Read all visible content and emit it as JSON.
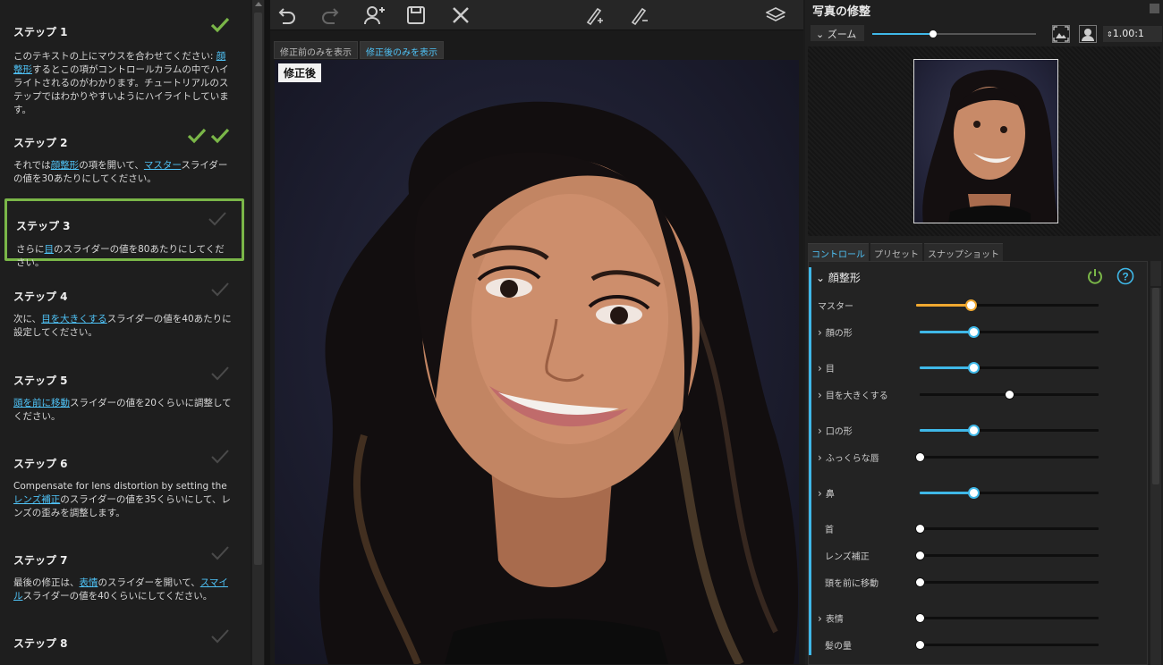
{
  "tutorial": {
    "steps": [
      {
        "title": "ステップ 1",
        "checks": 1,
        "done": true,
        "parts": [
          "このテキストの上にマウスを合わせてください: ",
          "顔整形",
          "するとこの項がコントロールカラムの中でハイライトされるのがわかります。チュートリアルのステップではわかりやすいようにハイライトしています。"
        ]
      },
      {
        "title": "ステップ 2",
        "checks": 2,
        "done": true,
        "parts": [
          "それでは",
          "顔整形",
          "の項を開いて、",
          "マスター",
          "スライダーの値を30あたりにしてください。"
        ]
      },
      {
        "title": "ステップ 3",
        "checks": 1,
        "done": false,
        "parts": [
          "さらに",
          "目",
          "のスライダーの値を80あたりにしてください。"
        ]
      },
      {
        "title": "ステップ 4",
        "checks": 1,
        "done": false,
        "parts": [
          "次に、",
          "目を大きくする",
          "スライダーの値を40あたりに設定してください。"
        ]
      },
      {
        "title": "ステップ 5",
        "checks": 1,
        "done": false,
        "parts": [
          "",
          "頭を前に移動",
          "スライダーの値を20くらいに調整してください。"
        ]
      },
      {
        "title": "ステップ 6",
        "checks": 1,
        "done": false,
        "parts": [
          "Compensate for lens distortion by setting the ",
          "レンズ補正",
          "のスライダーの値を35くらいにして、レンズの歪みを調整します。"
        ]
      },
      {
        "title": "ステップ 7",
        "checks": 1,
        "done": false,
        "parts": [
          "最後の修正は、",
          "表情",
          "のスライダーを開いて、",
          "スマイル",
          "スライダーの値を40くらいにしてください。"
        ]
      },
      {
        "title": "ステップ 8",
        "checks": 1,
        "done": false,
        "parts": []
      }
    ]
  },
  "view_tabs": [
    "修正前のみを表示",
    "修正後のみを表示"
  ],
  "photo_label": "修正後",
  "right_panel": {
    "title": "写真の修整",
    "zoom_label": "ズーム",
    "zoom_value": "1.00:1",
    "zoom_level": 0.37,
    "tabs": [
      "コントロール",
      "プリセット",
      "スナップショット"
    ],
    "section": "顔整形",
    "sliders": [
      {
        "label": "マスター",
        "value": 0.3,
        "color": "#f0a830",
        "expand": false,
        "indent": false
      },
      {
        "label": "顔の形",
        "value": 0.3,
        "color": "#3fb8e8",
        "expand": true,
        "indent": false
      },
      {
        "label": "目",
        "value": 0.3,
        "color": "#3fb8e8",
        "expand": true,
        "indent": false
      },
      {
        "label": "目を大きくする",
        "value": 0.5,
        "color": "",
        "expand": true,
        "indent": false
      },
      {
        "label": "口の形",
        "value": 0.3,
        "color": "#3fb8e8",
        "expand": true,
        "indent": false
      },
      {
        "label": "ふっくらな唇",
        "value": 0.0,
        "color": "",
        "expand": true,
        "indent": false
      },
      {
        "label": "鼻",
        "value": 0.3,
        "color": "#3fb8e8",
        "expand": true,
        "indent": false
      },
      {
        "label": "首",
        "value": 0.0,
        "color": "",
        "expand": false,
        "indent": true
      },
      {
        "label": "レンズ補正",
        "value": 0.0,
        "color": "",
        "expand": false,
        "indent": true
      },
      {
        "label": "頭を前に移動",
        "value": 0.0,
        "color": "",
        "expand": false,
        "indent": true
      },
      {
        "label": "表情",
        "value": 0.0,
        "color": "",
        "expand": true,
        "indent": false
      },
      {
        "label": "髪の量",
        "value": 0.0,
        "color": "",
        "expand": false,
        "indent": true
      }
    ]
  },
  "colors": {
    "accent": "#3fb8e8",
    "check": "#7ab648",
    "master": "#f0a830",
    "link": "#4fc3f7"
  }
}
